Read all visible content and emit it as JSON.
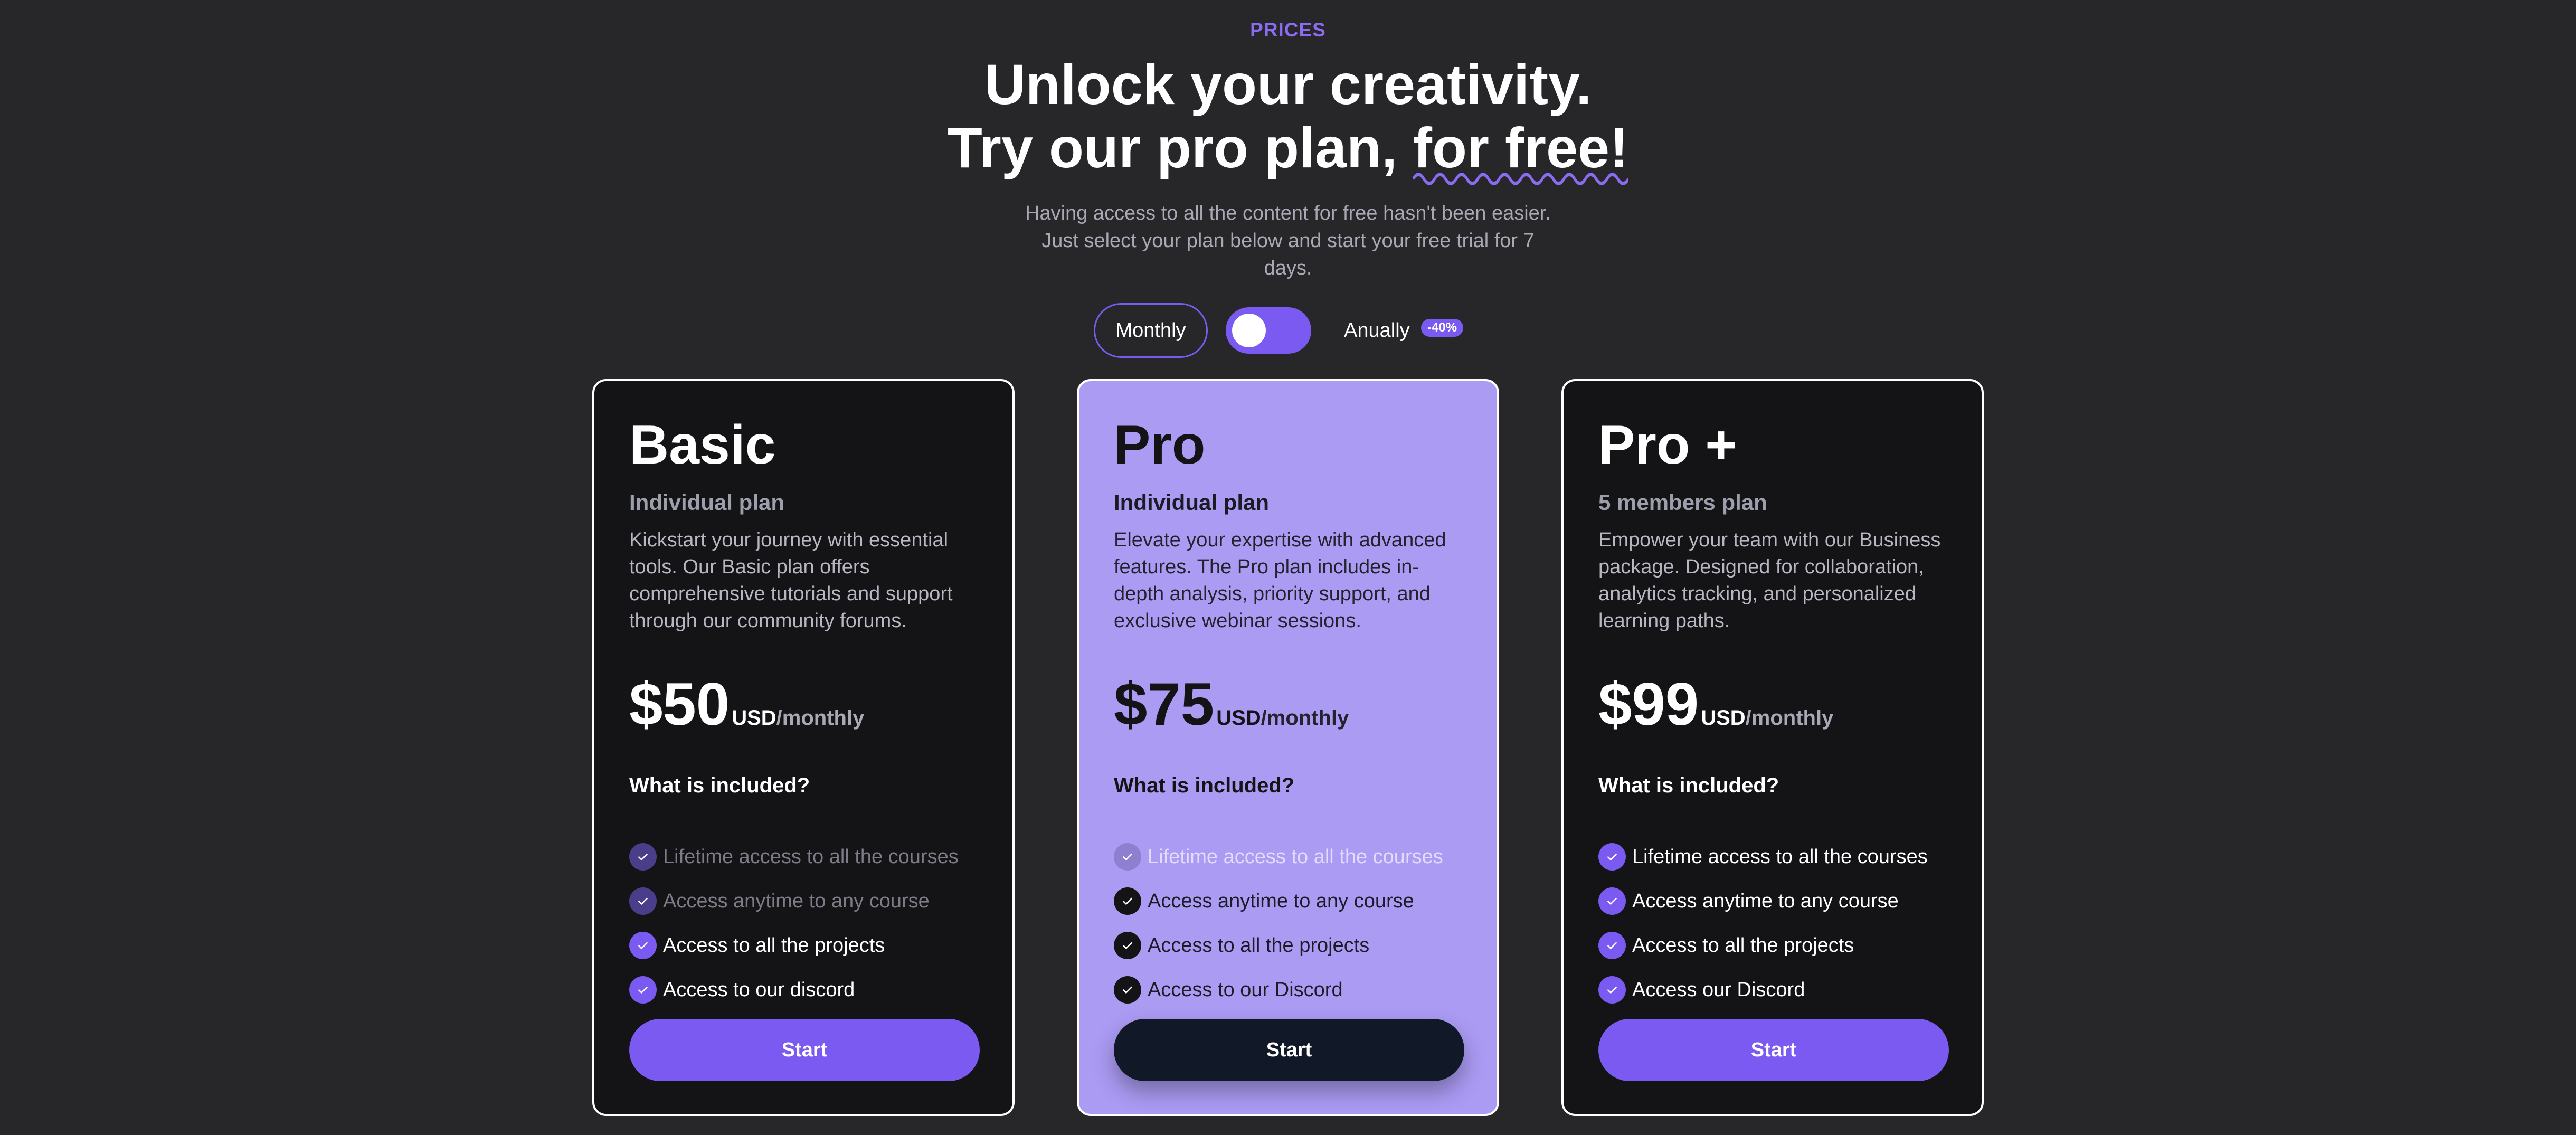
{
  "header": {
    "eyebrow": "PRICES",
    "headline_line1": "Unlock your creativity.",
    "headline_line2_prefix": "Try our pro plan, ",
    "headline_line2_accent": "for free!",
    "subtitle": "Having access to all the content for free hasn't been easier. Just select your plan below and start your free trial for 7 days."
  },
  "billing_toggle": {
    "monthly_label": "Monthly",
    "annually_label": "Anually",
    "discount_badge": "-40%",
    "selected": "Monthly"
  },
  "plans": [
    {
      "title": "Basic",
      "subtitle": "Individual plan",
      "description": "Kickstart your journey with essential tools. Our Basic plan offers comprehensive tutorials and support through our community forums.",
      "price": "$50",
      "currency": "USD",
      "period": "/monthly",
      "included_title": "What is included?",
      "features": [
        {
          "label": "Lifetime access to all the courses",
          "included": false
        },
        {
          "label": "Access anytime to any course",
          "included": false
        },
        {
          "label": "Access to all the projects",
          "included": true
        },
        {
          "label": "Access to our discord",
          "included": true
        }
      ],
      "button_label": "Start"
    },
    {
      "title": "Pro",
      "subtitle": "Individual plan",
      "description": "Elevate your expertise with advanced features. The Pro plan includes in-depth analysis, priority support, and exclusive webinar sessions.",
      "price": "$75",
      "currency": "USD",
      "period": "/monthly",
      "included_title": "What is included?",
      "features": [
        {
          "label": "Lifetime access to all the courses",
          "included": false
        },
        {
          "label": "Access anytime to any course",
          "included": true
        },
        {
          "label": "Access to all the projects",
          "included": true
        },
        {
          "label": "Access to our Discord",
          "included": true
        }
      ],
      "button_label": "Start"
    },
    {
      "title": "Pro +",
      "subtitle": "5 members plan",
      "description": "Empower your team with our Business package. Designed for collaboration, analytics tracking, and personalized learning paths.",
      "price": "$99",
      "currency": "USD",
      "period": "/monthly",
      "included_title": "What is included?",
      "features": [
        {
          "label": "Lifetime access to all the courses",
          "included": true
        },
        {
          "label": "Access anytime to any course",
          "included": true
        },
        {
          "label": "Access to all the projects",
          "included": true
        },
        {
          "label": "Access our Discord",
          "included": true
        }
      ],
      "button_label": "Start"
    }
  ],
  "colors": {
    "background": "#27272a",
    "accent": "#7a5af0",
    "card_dark": "#141417",
    "card_highlight": "#ab9bf3",
    "button_dark": "#111827"
  },
  "icons": {
    "feature_check": "check-icon",
    "headline_underline": "wavy-underline"
  }
}
